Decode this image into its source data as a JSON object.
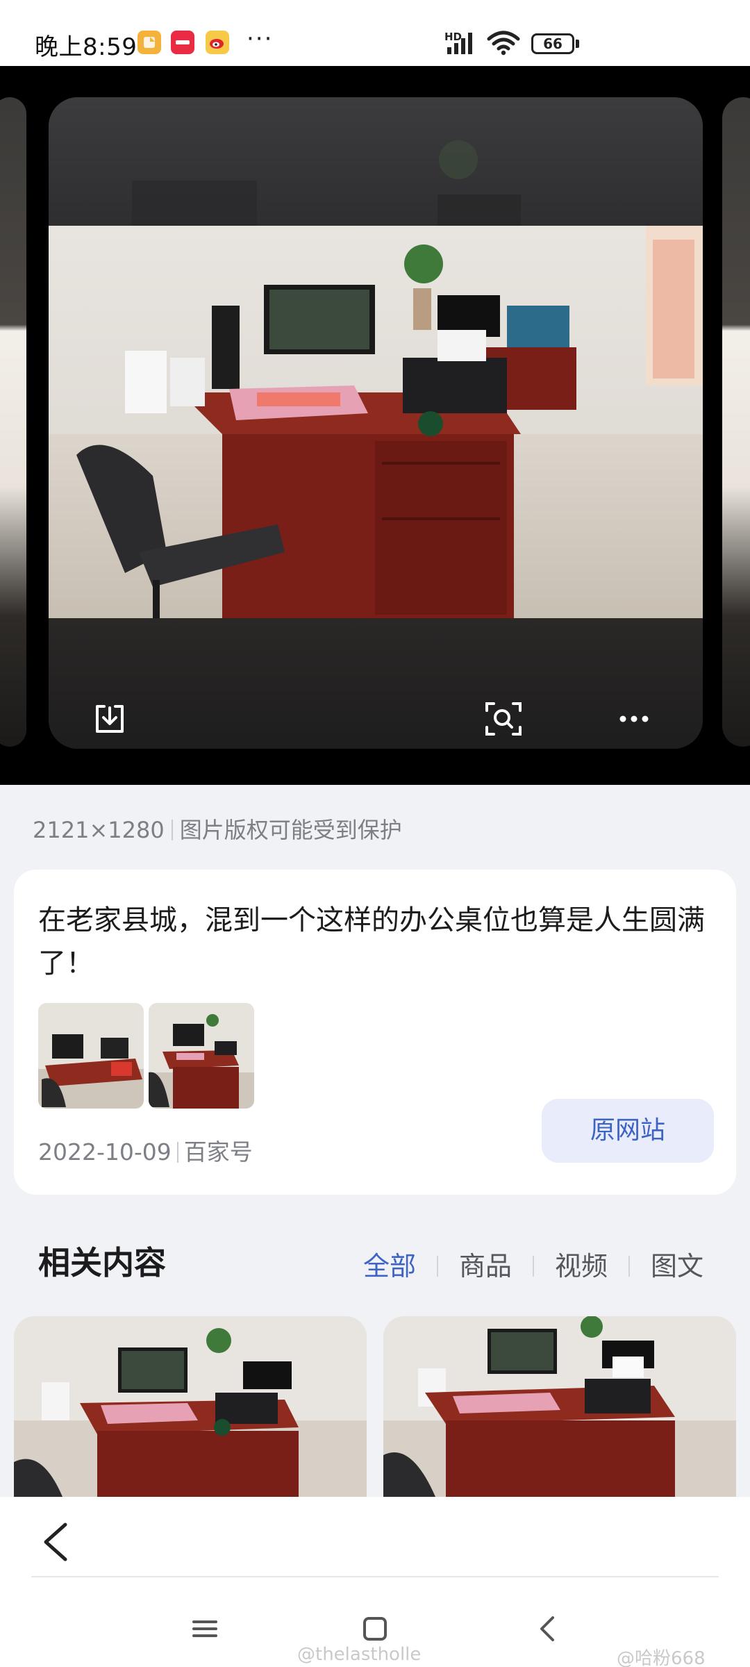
{
  "status_bar": {
    "time": "晚上8:59",
    "apps": [
      "notes-icon",
      "xiaohongshu-icon",
      "weibo-icon"
    ],
    "overflow": "···",
    "network": "HD",
    "battery": "66"
  },
  "viewer": {
    "actions": [
      "download-icon",
      "visual-search-icon",
      "more-icon"
    ]
  },
  "info": {
    "dimensions": "2121×1280",
    "copyright_note": "图片版权可能受到保护"
  },
  "source": {
    "title": "在老家县城，混到一个这样的办公桌位也算是人生圆满了！",
    "date": "2022-10-09",
    "publisher": "百家号",
    "button": "原网站"
  },
  "related": {
    "title": "相关内容",
    "filters": [
      "全部",
      "商品",
      "视频",
      "图文"
    ],
    "active_filter": "全部"
  },
  "watermarks": [
    "@thelastholle",
    "@哈粉668"
  ],
  "colors": {
    "accent": "#3e63c6",
    "accent_bg": "#e8ecfb"
  }
}
